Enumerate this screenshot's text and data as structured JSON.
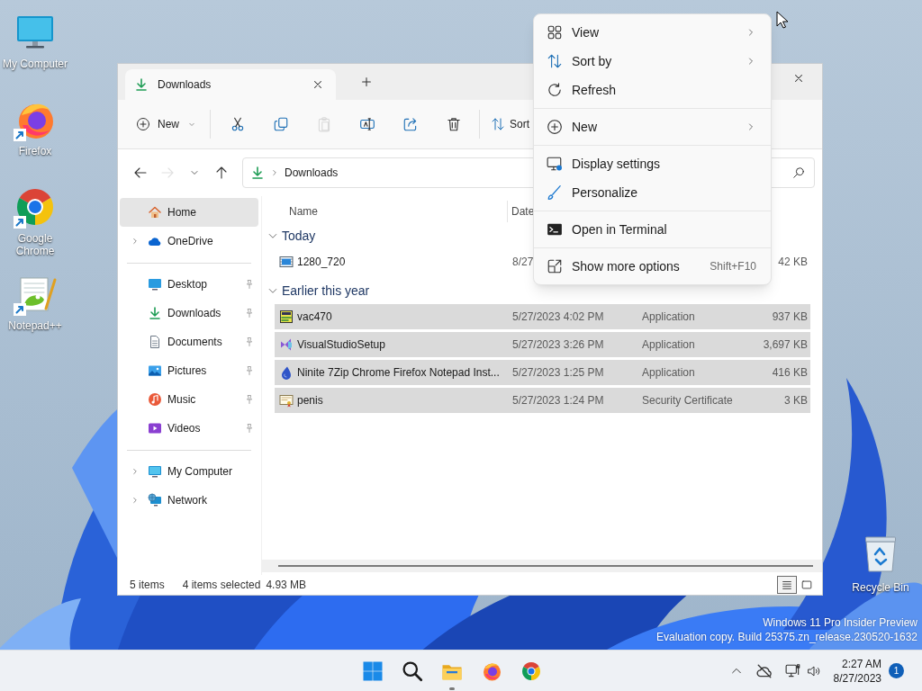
{
  "desktop_icons": [
    {
      "label": "My Computer",
      "kind": "computer",
      "shortcut": false
    },
    {
      "label": "Firefox",
      "kind": "firefox",
      "shortcut": true
    },
    {
      "label": "Google Chrome",
      "kind": "chrome",
      "shortcut": true
    },
    {
      "label": "Notepad++",
      "kind": "notepad",
      "shortcut": true
    }
  ],
  "recycle_bin": {
    "label": "Recycle Bin"
  },
  "explorer": {
    "tabs": [
      {
        "label": "Downloads",
        "selected": true
      }
    ],
    "toolbar": [
      {
        "kind": "new",
        "label": "New",
        "disabled": false
      },
      {
        "kind": "cut",
        "disabled": false
      },
      {
        "kind": "copy",
        "disabled": false
      },
      {
        "kind": "paste",
        "disabled": true
      },
      {
        "kind": "rename",
        "disabled": false
      },
      {
        "kind": "share",
        "disabled": false
      },
      {
        "kind": "delete",
        "disabled": false
      },
      {
        "kind": "sort",
        "label": "Sort",
        "disabled": false
      }
    ],
    "nav": [
      {
        "kind": "back",
        "disabled": false
      },
      {
        "kind": "forward",
        "disabled": true
      },
      {
        "kind": "recent",
        "disabled": false
      },
      {
        "kind": "up",
        "disabled": false
      }
    ],
    "address": {
      "path": "Downloads"
    },
    "sidebar": [
      [
        {
          "label": "Home",
          "kind": "home",
          "selected": true,
          "expandable": false,
          "pinned": false
        },
        {
          "label": "OneDrive",
          "kind": "cloud",
          "selected": false,
          "expandable": true,
          "pinned": false
        }
      ],
      [
        {
          "label": "Desktop",
          "kind": "desktop",
          "selected": false,
          "expandable": false,
          "pinned": true
        },
        {
          "label": "Downloads",
          "kind": "downloads",
          "selected": false,
          "expandable": false,
          "pinned": true
        },
        {
          "label": "Documents",
          "kind": "documents",
          "selected": false,
          "expandable": false,
          "pinned": true
        },
        {
          "label": "Pictures",
          "kind": "pictures",
          "selected": false,
          "expandable": false,
          "pinned": true
        },
        {
          "label": "Music",
          "kind": "music",
          "selected": false,
          "expandable": false,
          "pinned": true
        },
        {
          "label": "Videos",
          "kind": "videos",
          "selected": false,
          "expandable": false,
          "pinned": true
        }
      ],
      [
        {
          "label": "My Computer",
          "kind": "computer",
          "selected": false,
          "expandable": true,
          "pinned": false
        },
        {
          "label": "Network",
          "kind": "network",
          "selected": false,
          "expandable": true,
          "pinned": false
        }
      ]
    ],
    "columns": [
      "Name",
      "Date"
    ],
    "groups": [
      {
        "label": "Today",
        "expanded": true,
        "files": [
          {
            "name": "1280_720",
            "kind": "image",
            "date": "8/27",
            "size": "42 KB",
            "selected": false
          }
        ]
      },
      {
        "label": "Earlier this year",
        "expanded": true,
        "files": [
          {
            "name": "vac470",
            "kind": "app",
            "date": "5/27/2023 4:02 PM",
            "type": "Application",
            "size": "937 KB",
            "selected": true
          },
          {
            "name": "VisualStudioSetup",
            "kind": "vs",
            "date": "5/27/2023 3:26 PM",
            "type": "Application",
            "size": "3,697 KB",
            "selected": true
          },
          {
            "name": "Ninite 7Zip Chrome Firefox Notepad Inst...",
            "kind": "ninite",
            "date": "5/27/2023 1:25 PM",
            "type": "Application",
            "size": "416 KB",
            "selected": true
          },
          {
            "name": "penis",
            "kind": "certificate",
            "date": "5/27/2023 1:24 PM",
            "type": "Security Certificate",
            "size": "3 KB",
            "selected": true
          }
        ]
      }
    ],
    "status_bar": {
      "count": "5 items",
      "selection": "4 items selected",
      "size": "4.93 MB"
    },
    "views": [
      {
        "kind": "details",
        "selected": true
      },
      {
        "kind": "tiles",
        "selected": false
      }
    ]
  },
  "context_menu": [
    [
      {
        "label": "View",
        "kind": "view",
        "submenu": true
      },
      {
        "label": "Sort by",
        "kind": "sort",
        "submenu": true
      },
      {
        "label": "Refresh",
        "kind": "refresh",
        "submenu": false
      }
    ],
    [
      {
        "label": "New",
        "kind": "new",
        "submenu": true
      }
    ],
    [
      {
        "label": "Display settings",
        "kind": "display",
        "submenu": false
      },
      {
        "label": "Personalize",
        "kind": "brush",
        "submenu": false
      }
    ],
    [
      {
        "label": "Open in Terminal",
        "kind": "terminal",
        "submenu": false
      }
    ],
    [
      {
        "label": "Show more options",
        "kind": "more",
        "submenu": false,
        "shortcut": "Shift+F10"
      }
    ]
  ],
  "watermark": [
    "Windows 11 Pro Insider Preview",
    "Evaluation copy. Build 25375.zn_release.230520-1632"
  ],
  "taskbar": {
    "apps": [
      {
        "kind": "start",
        "running": false
      },
      {
        "kind": "search",
        "running": false
      },
      {
        "kind": "explorer",
        "running": true
      },
      {
        "kind": "firefox",
        "running": false
      },
      {
        "kind": "chrome",
        "running": false
      }
    ],
    "tray": {
      "time": "2:27 AM",
      "date": "8/27/2023",
      "notifications": "1"
    }
  }
}
